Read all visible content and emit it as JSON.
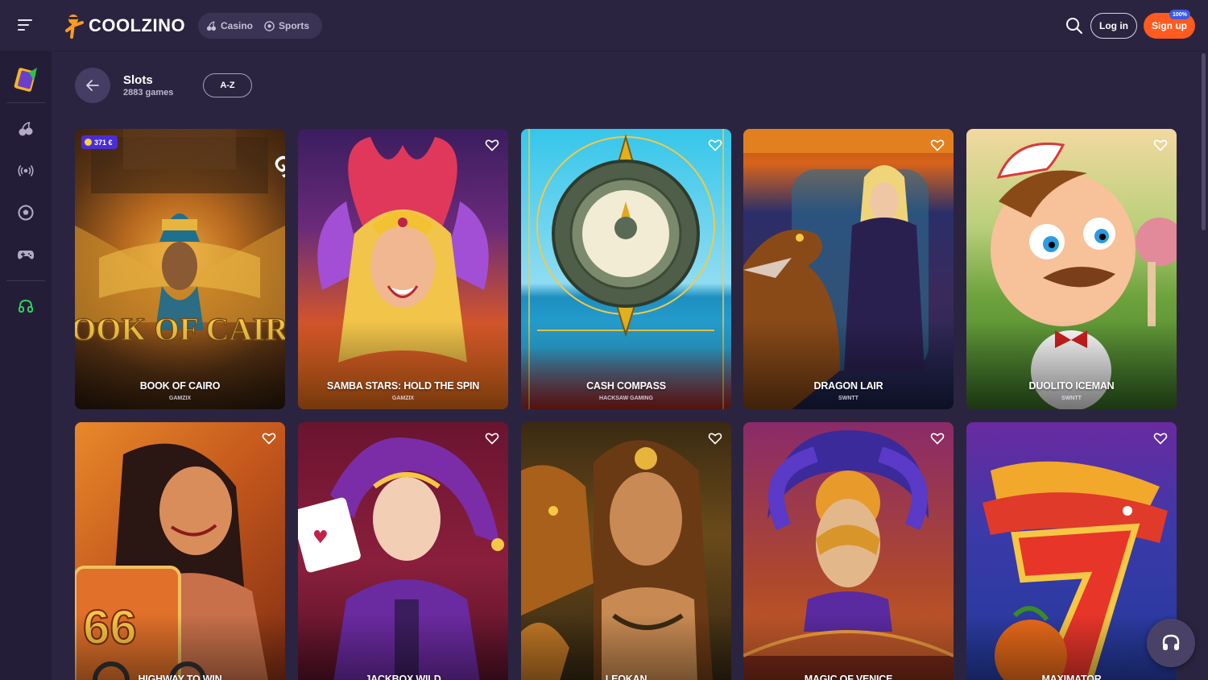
{
  "header": {
    "logo_text": "COOLZINO",
    "nav": [
      {
        "label": "Casino",
        "icon": "cherries-icon"
      },
      {
        "label": "Sports",
        "icon": "soccer-ball-icon"
      }
    ],
    "login_label": "Log in",
    "signup_label": "Sign up",
    "signup_badge": "100%",
    "accent_color": "#ff5a1f"
  },
  "sidebar": {
    "items": [
      {
        "name": "promo-card",
        "icon": "bonus-card-icon"
      },
      {
        "name": "casino",
        "icon": "cherries-icon"
      },
      {
        "name": "live",
        "icon": "broadcast-icon"
      },
      {
        "name": "sports",
        "icon": "soccer-ball-icon"
      },
      {
        "name": "games",
        "icon": "gamepad-icon"
      },
      {
        "name": "support",
        "icon": "headset-icon"
      }
    ]
  },
  "page": {
    "title": "Slots",
    "subtitle": "2883 games",
    "sort_label": "A-Z"
  },
  "games": [
    {
      "title": "BOOK OF CAIRO",
      "provider": "GAMZIX",
      "jackpot": "371 €"
    },
    {
      "title": "SAMBA STARS: HOLD THE SPIN",
      "provider": "GAMZIX"
    },
    {
      "title": "CASH COMPASS",
      "provider": "HACKSAW GAMING"
    },
    {
      "title": "DRAGON LAIR",
      "provider": "SWNTT"
    },
    {
      "title": "DUOLITO ICEMAN",
      "provider": "SWNTT"
    },
    {
      "title": "HIGHWAY TO WIN",
      "provider": ""
    },
    {
      "title": "JACKBOX WILD",
      "provider": ""
    },
    {
      "title": "LEOKAN",
      "provider": ""
    },
    {
      "title": "MAGIC OF VENICE",
      "provider": ""
    },
    {
      "title": "MAXIMATOR",
      "provider": ""
    }
  ]
}
